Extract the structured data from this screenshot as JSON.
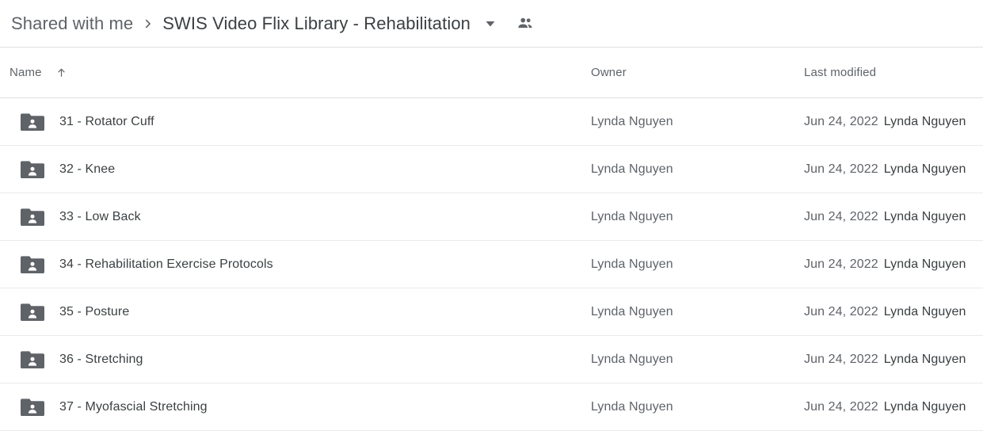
{
  "breadcrumb": {
    "parent_label": "Shared with me",
    "separator_icon": "chevron-right-icon",
    "current_label": "SWIS Video Flix Library - Rehabilitation",
    "caret_icon": "chevron-down-icon",
    "people_icon": "people-shared-icon"
  },
  "table": {
    "columns": {
      "name": "Name",
      "owner": "Owner",
      "last_modified": "Last modified"
    },
    "sort": {
      "column": "Name",
      "direction_icon": "arrow-up-icon"
    },
    "rows": [
      {
        "icon": "shared-folder-icon",
        "name": "31 - Rotator Cuff",
        "owner": "Lynda Nguyen",
        "modified_date": "Jun 24, 2022",
        "modified_by": "Lynda Nguyen"
      },
      {
        "icon": "shared-folder-icon",
        "name": "32 - Knee",
        "owner": "Lynda Nguyen",
        "modified_date": "Jun 24, 2022",
        "modified_by": "Lynda Nguyen"
      },
      {
        "icon": "shared-folder-icon",
        "name": "33 - Low Back",
        "owner": "Lynda Nguyen",
        "modified_date": "Jun 24, 2022",
        "modified_by": "Lynda Nguyen"
      },
      {
        "icon": "shared-folder-icon",
        "name": "34 - Rehabilitation Exercise Protocols",
        "owner": "Lynda Nguyen",
        "modified_date": "Jun 24, 2022",
        "modified_by": "Lynda Nguyen"
      },
      {
        "icon": "shared-folder-icon",
        "name": "35 - Posture",
        "owner": "Lynda Nguyen",
        "modified_date": "Jun 24, 2022",
        "modified_by": "Lynda Nguyen"
      },
      {
        "icon": "shared-folder-icon",
        "name": "36 - Stretching",
        "owner": "Lynda Nguyen",
        "modified_date": "Jun 24, 2022",
        "modified_by": "Lynda Nguyen"
      },
      {
        "icon": "shared-folder-icon",
        "name": "37 - Myofascial Stretching",
        "owner": "Lynda Nguyen",
        "modified_date": "Jun 24, 2022",
        "modified_by": "Lynda Nguyen"
      }
    ]
  },
  "colors": {
    "icon_gray": "#5f6368",
    "text_primary": "#3c4043",
    "text_secondary": "#5f6368",
    "divider": "#e0e0e0",
    "row_divider": "#e8eaed"
  }
}
